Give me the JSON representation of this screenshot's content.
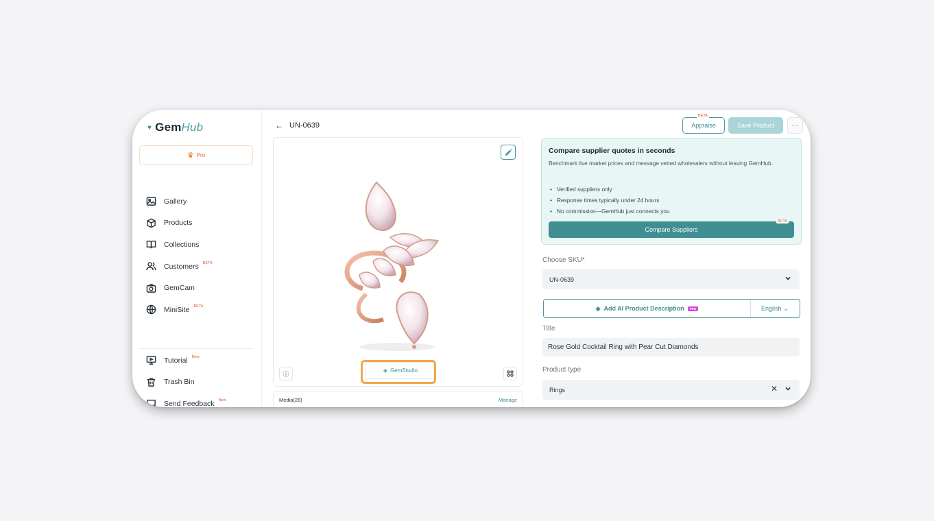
{
  "brand": {
    "name_a": "Gem",
    "name_b": "Hub"
  },
  "plan": {
    "label": "Pro"
  },
  "sidebar": {
    "items": [
      {
        "label": "Gallery",
        "icon": "image-icon",
        "badge": ""
      },
      {
        "label": "Products",
        "icon": "box-icon",
        "badge": ""
      },
      {
        "label": "Collections",
        "icon": "book-icon",
        "badge": ""
      },
      {
        "label": "Customers",
        "icon": "users-icon",
        "badge": "BETA"
      },
      {
        "label": "GemCam",
        "icon": "camera-icon",
        "badge": ""
      },
      {
        "label": "MiniSite",
        "icon": "globe-icon",
        "badge": "BETA"
      }
    ],
    "bottom": [
      {
        "label": "Tutorial",
        "icon": "presentation-icon",
        "badge": "New"
      },
      {
        "label": "Trash Bin",
        "icon": "trash-icon",
        "badge": ""
      },
      {
        "label": "Send Feedback",
        "icon": "feedback-icon",
        "badge": "New"
      }
    ]
  },
  "header": {
    "sku": "UN-0639",
    "appraise_label": "Appraise",
    "appraise_badge": "BETA",
    "save_label": "Save Product",
    "more_label": "···"
  },
  "media": {
    "studio_label": "GemStudio",
    "title": "Media(28)",
    "manage_label": "Manage"
  },
  "promo": {
    "title": "Compare supplier quotes in seconds",
    "description": "Benchmark live market prices and message vetted wholesalers without leaving GemHub.",
    "bullets": [
      "Verified suppliers only",
      "Response times typically under 24 hours",
      "No commission—GemHub just connects you"
    ],
    "button_label": "Compare Suppliers",
    "button_badge": "BETA"
  },
  "form": {
    "sku_label": "Choose SKU*",
    "sku_value": "UN-0639",
    "ai_label": "Add AI Product Description",
    "ai_badge": "PRO",
    "language": "English",
    "title_label": "Title",
    "title_value": "Rose Gold Cocktail Ring with Pear Cut Diamonds",
    "type_label": "Product type",
    "type_value": "Rings"
  },
  "colors": {
    "accent": "#3f8e92",
    "badge": "#e05a2a",
    "highlight": "#f0a848"
  }
}
